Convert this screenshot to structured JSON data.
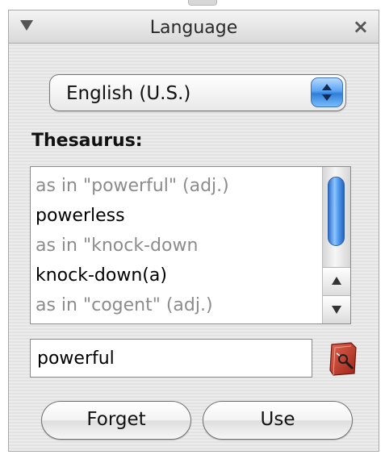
{
  "window": {
    "title": "Language",
    "close_glyph": "×",
    "disclosure_icon": "disclosure-triangle-down"
  },
  "language_popup": {
    "selected": "English (U.S.)"
  },
  "thesaurus": {
    "label": "Thesaurus:",
    "items": [
      {
        "text": "as in \"powerful\" (adj.)",
        "kind": "heading"
      },
      {
        "text": "powerless",
        "kind": "word"
      },
      {
        "text": "as in \"knock-down",
        "kind": "heading"
      },
      {
        "text": "knock-down(a)",
        "kind": "word"
      },
      {
        "text": "as in \"cogent\" (adj.)",
        "kind": "heading"
      }
    ]
  },
  "word_field": {
    "value": "powerful"
  },
  "buttons": {
    "forget": "Forget",
    "use": "Use"
  },
  "colors": {
    "accent_blue": "#4a93ea",
    "heading_gray": "#8c8c8c",
    "dictionary_red": "#c0392b"
  }
}
